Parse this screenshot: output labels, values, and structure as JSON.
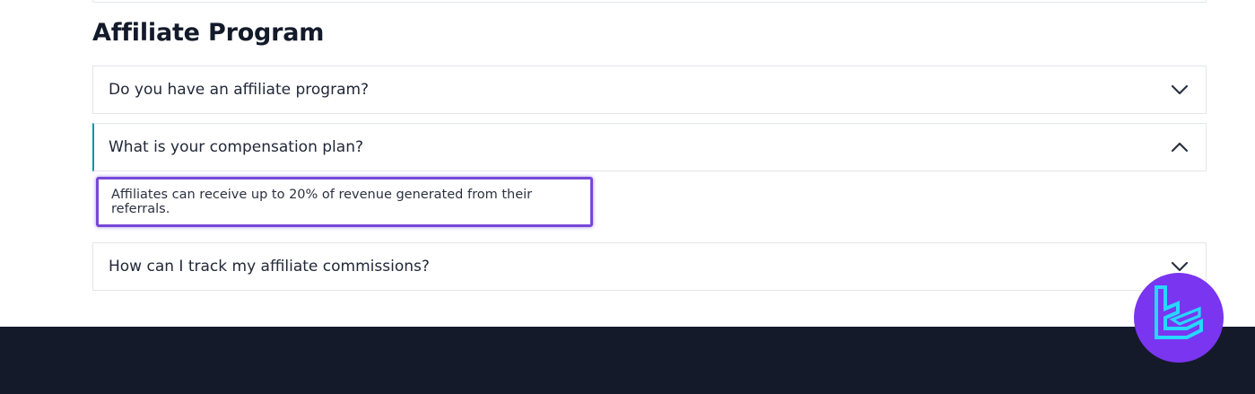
{
  "section": {
    "title": "Affiliate Program"
  },
  "faq": {
    "items": [
      {
        "question": "Do you have an affiliate program?",
        "state": "collapsed",
        "icon": "chevron-down-icon"
      },
      {
        "question": "What is your compensation plan?",
        "state": "expanded",
        "icon": "chevron-up-icon",
        "answer": "Affiliates can receive up to 20% of revenue generated from their referrals."
      },
      {
        "question": "How can I track my affiliate commissions?",
        "state": "collapsed",
        "icon": "chevron-down-icon"
      }
    ]
  },
  "colors": {
    "accent_border": "#0e93a8",
    "highlight_box": "#7748d9",
    "footer_bg": "#141a2a",
    "logo_bg": "#7a35f0",
    "logo_glyph": "#27d7ff"
  },
  "logo": {
    "icon": "brand-logo-icon"
  }
}
